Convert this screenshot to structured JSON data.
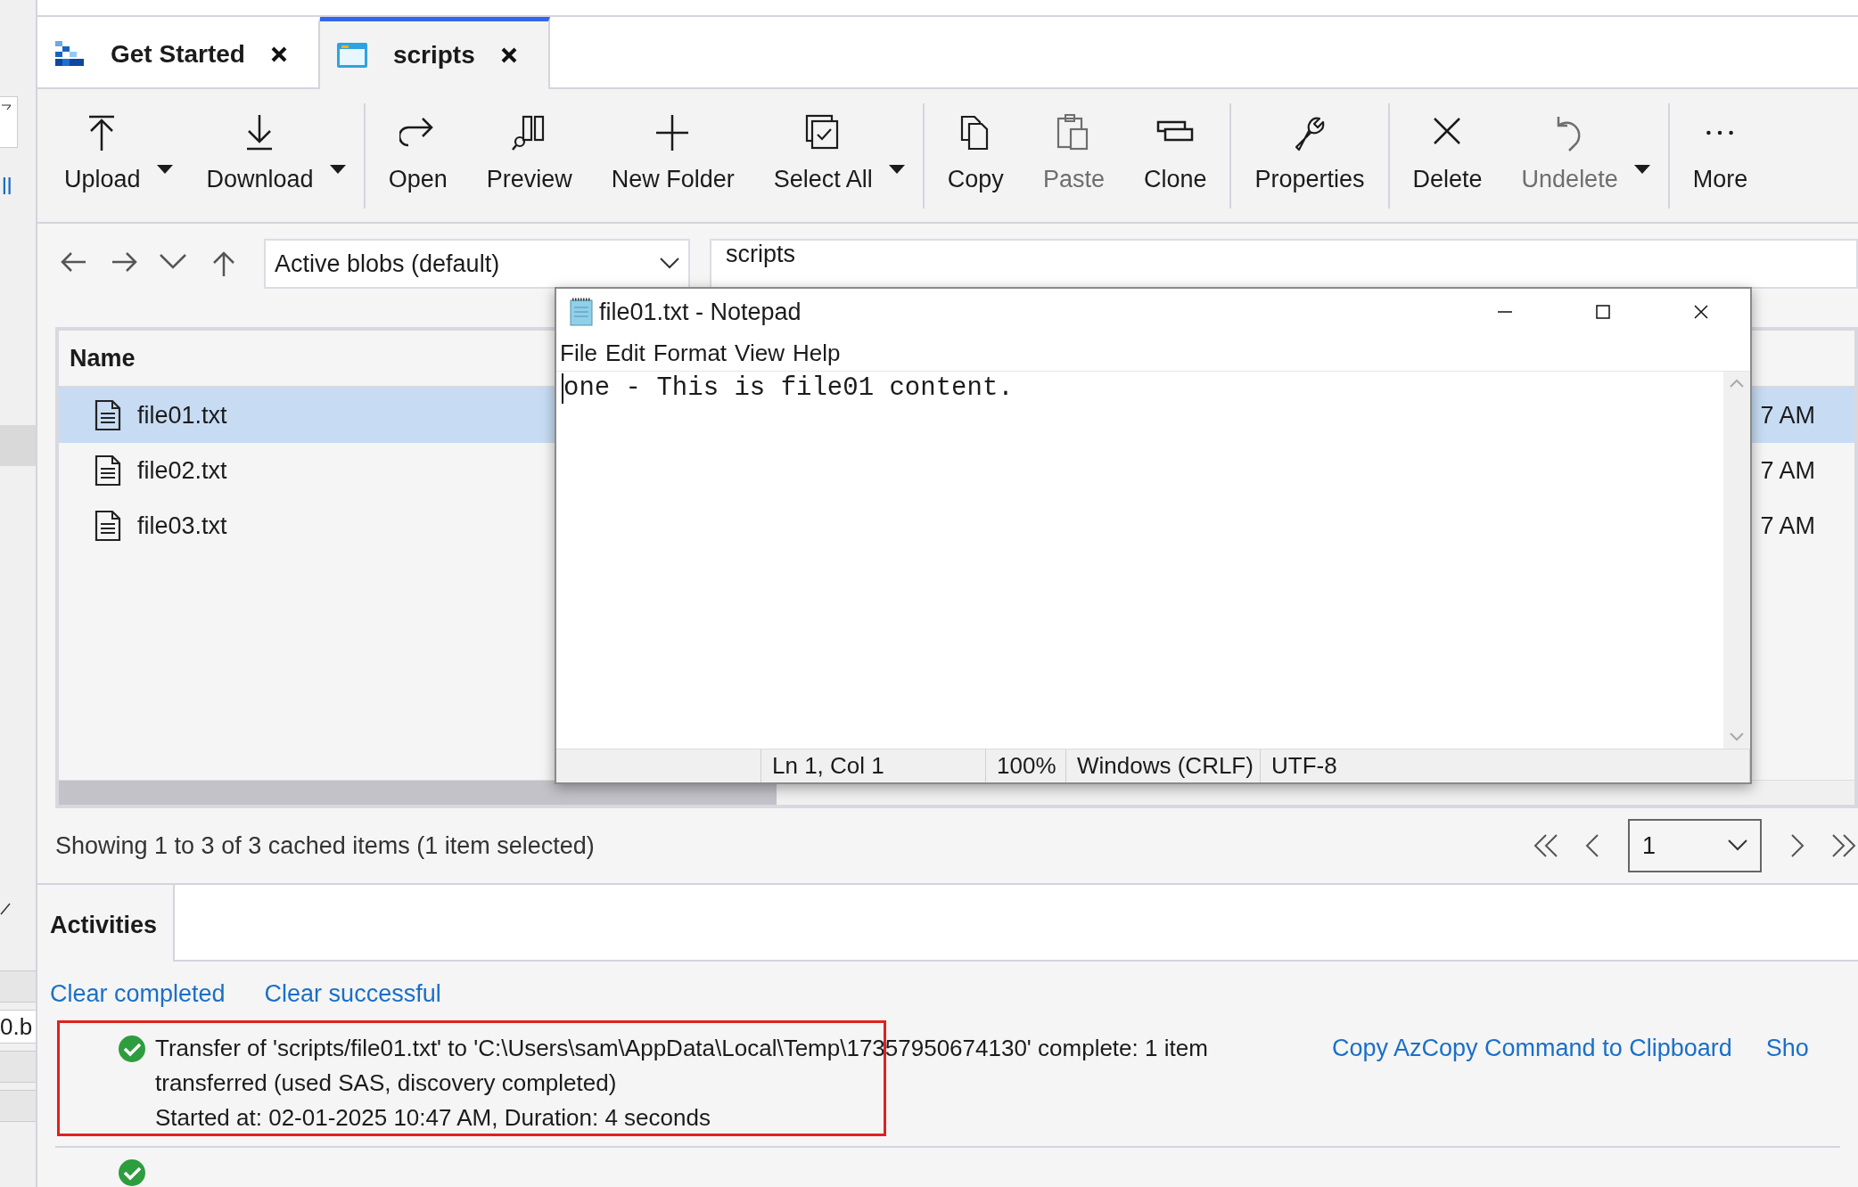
{
  "left_strip": {
    "link_fragment": "ll",
    "item_fragment": "0.b"
  },
  "tabs": [
    {
      "label": "Get Started",
      "kind": "start",
      "selected": false
    },
    {
      "label": "scripts",
      "kind": "container",
      "selected": true
    }
  ],
  "toolbar": [
    [
      {
        "label": "Upload",
        "disabled": false,
        "dropdown": true
      },
      {
        "label": "Download",
        "disabled": false,
        "dropdown": true
      }
    ],
    [
      {
        "label": "Open",
        "disabled": false,
        "dropdown": false
      },
      {
        "label": "Preview",
        "disabled": false,
        "dropdown": false
      },
      {
        "label": "New Folder",
        "disabled": false,
        "dropdown": false
      },
      {
        "label": "Select All",
        "disabled": false,
        "dropdown": true
      }
    ],
    [
      {
        "label": "Copy",
        "disabled": false,
        "dropdown": false
      },
      {
        "label": "Paste",
        "disabled": true,
        "dropdown": false
      },
      {
        "label": "Clone",
        "disabled": false,
        "dropdown": false
      }
    ],
    [
      {
        "label": "Properties",
        "disabled": false,
        "dropdown": false
      }
    ],
    [
      {
        "label": "Delete",
        "disabled": false,
        "dropdown": false
      },
      {
        "label": "Undelete",
        "disabled": true,
        "dropdown": true
      }
    ],
    [
      {
        "label": "More",
        "disabled": false,
        "dropdown": false
      }
    ]
  ],
  "nav": {
    "view_select": "Active blobs (default)",
    "path": "scripts"
  },
  "files": {
    "columns": [
      "Name"
    ],
    "rows": [
      {
        "name": "file01.txt",
        "time": "7 AM",
        "selected": true
      },
      {
        "name": "file02.txt",
        "time": "7 AM",
        "selected": false
      },
      {
        "name": "file03.txt",
        "time": "7 AM",
        "selected": false
      }
    ]
  },
  "status": "Showing 1 to 3 of 3 cached items (1 item selected)",
  "pager": {
    "page": "1"
  },
  "activities": {
    "tab": "Activities",
    "links": [
      "Clear completed",
      "Clear successful"
    ],
    "items": [
      {
        "highlighted": true,
        "message": "Transfer of 'scripts/file01.txt' to 'C:\\Users\\sam\\AppData\\Local\\Temp\\17357950674130' complete: 1 item transferred (used SAS, discovery completed)",
        "detail": "Started at: 02-01-2025 10:47 AM, Duration: 4 seconds",
        "actions": [
          "Copy AzCopy Command to Clipboard",
          "Sho"
        ]
      },
      {
        "highlighted": false
      }
    ]
  },
  "notepad": {
    "title": "file01.txt - Notepad",
    "menu": [
      "File",
      "Edit",
      "Format",
      "View",
      "Help"
    ],
    "content": "one - This is file01 content.",
    "status": [
      "Ln 1, Col 1",
      "100%",
      "Windows (CRLF)",
      "UTF-8"
    ]
  }
}
